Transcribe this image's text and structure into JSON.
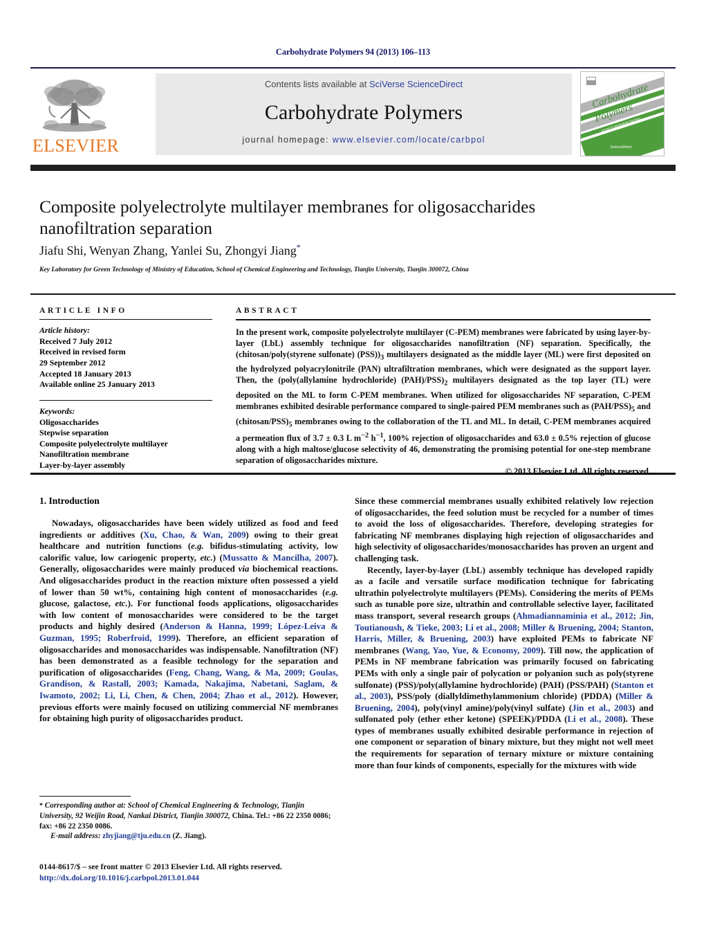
{
  "running_head": "Carbohydrate Polymers 94 (2013) 106–113",
  "header": {
    "publisher_name": "ELSEVIER",
    "contents_prefix": "Contents lists available at ",
    "contents_link": "SciVerse ScienceDirect",
    "journal_title": "Carbohydrate Polymers",
    "homepage_prefix": "journal homepage: ",
    "homepage_url": "www.elsevier.com/locate/carbpol",
    "cover_title_line1": "Carbohydrate",
    "cover_title_line2": "Polymers",
    "cover_footer": "ScienceDirect",
    "accent_orange": "#e87722",
    "accent_blue": "#2b3c9e",
    "band_gray": "#e9e9e9",
    "rule_dark": "#231f20"
  },
  "article": {
    "title": "Composite polyelectrolyte multilayer membranes for oligosaccharides nanofiltration separation",
    "authors": "Jiafu Shi, Wenyan Zhang, Yanlei Su, Zhongyi Jiang",
    "corresponding_marker": "*",
    "affiliation": "Key Laboratory for Green Technology of Ministry of Education, School of Chemical Engineering and Technology, Tianjin University, Tianjin 300072, China"
  },
  "article_info": {
    "heading": "ARTICLE INFO",
    "history_label": "Article history:",
    "history": [
      "Received 7 July 2012",
      "Received in revised form",
      "29 September 2012",
      "Accepted 18 January 2013",
      "Available online 25 January 2013"
    ],
    "keywords_label": "Keywords:",
    "keywords": [
      "Oligosaccharides",
      "Stepwise separation",
      "Composite polyelectrolyte multilayer",
      "Nanofiltration membrane",
      "Layer-by-layer assembly"
    ]
  },
  "abstract": {
    "heading": "ABSTRACT",
    "body_part1": "In the present work, composite polyelectrolyte multilayer (C-PEM) membranes were fabricated by using layer-by-layer (LbL) assembly technique for oligosaccharides nanofiltration (NF) separation. Specifically, the (chitosan/poly(styrene sulfonate) (PSS))",
    "sub1": "3",
    "body_part2": " multilayers designated as the middle layer (ML) were first deposited on the hydrolyzed polyacrylonitrile (PAN) ultrafiltration membranes, which were designated as the support layer. Then, the (poly(allylamine hydrochloride) (PAH)/PSS)",
    "sub2": "2",
    "body_part3": " multilayers designated as the top layer (TL) were deposited on the ML to form C-PEM membranes. When utilized for oligosaccharides NF separation, C-PEM membranes exhibited desirable performance compared to single-paired PEM membranes such as (PAH/PSS)",
    "sub3": "5",
    "body_part4": " and (chitosan/PSS)",
    "sub4": "5",
    "body_part5": " membranes owing to the collaboration of the TL and ML. In detail, C-PEM membranes acquired a permeation flux of 3.7 ± 0.3 L m",
    "sup1": "−2",
    "body_part6": " h",
    "sup2": "−1",
    "body_part7": ", 100% rejection of oligosaccharides and 63.0 ± 0.5% rejection of glucose along with a high maltose/glucose selectivity of 46, demonstrating the promising potential for one-step membrane separation of oligosaccharides mixture.",
    "copyright": "© 2013 Elsevier Ltd. All rights reserved."
  },
  "body": {
    "section_number_title": "1.  Introduction",
    "left_paragraph_1": {
      "seg1": "Nowadays, oligosaccharides have been widely utilized as food and feed ingredients or additives (",
      "ref1": "Xu, Chao, & Wan, 2009",
      "seg2": ") owing to their great healthcare and nutrition functions (",
      "ital1": "e.g.",
      "seg3": " bifidus-stimulating activity, low calorific value, low cariogenic property, ",
      "ital2": "etc.",
      "seg4": ") (",
      "ref2": "Mussatto & Mancilha, 2007",
      "seg5": "). Generally, oligosaccharides were mainly produced ",
      "ital3": "via",
      "seg6": " biochemical reactions. And oligosaccharides product in the reaction mixture often possessed a yield of lower than 50 wt%, containing high content of monosaccharides (",
      "ital4": "e.g.",
      "seg7": " glucose, galactose, ",
      "ital5": "etc.",
      "seg8": "). For functional foods applications, oligosaccharides with low content of monosaccharides were considered to be the target products and highly desired (",
      "ref3": "Anderson & Hanna, 1999; López-Leiva & Guzman, 1995; Roberfroid, 1999",
      "seg9": "). Therefore, an efficient separation of oligosaccharides and monosaccharides was indispensable. Nanofiltration (NF) has been demonstrated as a feasible technology for the separation and purification of oligosaccharides (",
      "ref4": "Feng, Chang, Wang, & Ma, 2009; Goulas, Grandison, & Rastall, 2003; Kamada, Nakajima, Nabetani, Saglam, & Iwamoto, 2002; Li, Li, Chen, & Chen, 2004; Zhao et al., 2012",
      "seg10": "). However, previous efforts were mainly focused on utilizing commercial NF membranes for obtaining high purity of oligosaccharides product."
    },
    "right_paragraph_1": {
      "seg1": "Since these commercial membranes usually exhibited relatively low rejection of oligosaccharides, the feed solution must be recycled for a number of times to avoid the loss of oligosaccharides. Therefore, developing strategies for fabricating NF membranes displaying high rejection of oligosaccharides and high selectivity of oligosaccharides/monosaccharides has proven an urgent and challenging task."
    },
    "right_paragraph_2": {
      "seg1": "Recently, layer-by-layer (LbL) assembly technique has developed rapidly as a facile and versatile surface modification technique for fabricating ultrathin polyelectrolyte multilayers (PEMs). Considering the merits of PEMs such as tunable pore size, ultrathin and controllable selective layer, facilitated mass transport, several research groups (",
      "ref1": "Ahmadiannaminia et al., 2012; Jin, Toutianoush, & Tieke, 2003; Li et al., 2008; Miller & Bruening, 2004; Stanton, Harris, Miller, & Bruening, 2003",
      "seg2": ") have exploited PEMs to fabricate NF membranes (",
      "ref2": "Wang, Yao, Yue, & Economy, 2009",
      "seg3": "). Till now, the application of PEMs in NF membrane fabrication was primarily focused on fabricating PEMs with only a single pair of polycation or polyanion such as poly(styrene sulfonate) (PSS)/poly(allylamine hydrochloride) (PAH) (PSS/PAH) (",
      "ref3": "Stanton et al., 2003",
      "seg4": "), PSS/poly (diallyldimethylammonium chloride) (PDDA) (",
      "ref4": "Miller & Bruening, 2004",
      "seg5": "), poly(vinyl amine)/poly(vinyl sulfate) (",
      "ref5": "Jin et al., 2003",
      "seg6": ") and sulfonated poly (ether ether ketone) (SPEEK)/PDDA (",
      "ref6": "Li et al., 2008",
      "seg7": "). These types of membranes usually exhibited desirable performance in rejection of one component or separation of binary mixture, but they might not well meet the requirements for separation of ternary mixture or mixture containing more than four kinds of components, especially for the mixtures with wide"
    }
  },
  "footnote": {
    "star": "*",
    "line1": " Corresponding author at: School of Chemical Engineering & Technology, Tianjin University, 92 Weijin Road, Nankai District, Tianjin 300072,",
    "line2": "China. Tel.: +86 22 2350 0086; fax: +86 22 2350 0086.",
    "email_label": "E-mail address:",
    "email": "zhyjiang@tju.edu.cn",
    "email_suffix": " (Z. Jiang)."
  },
  "issn": {
    "line": "0144-8617/$ – see front matter © 2013 Elsevier Ltd. All rights reserved.",
    "doi": "http://dx.doi.org/10.1016/j.carbpol.2013.01.044"
  }
}
